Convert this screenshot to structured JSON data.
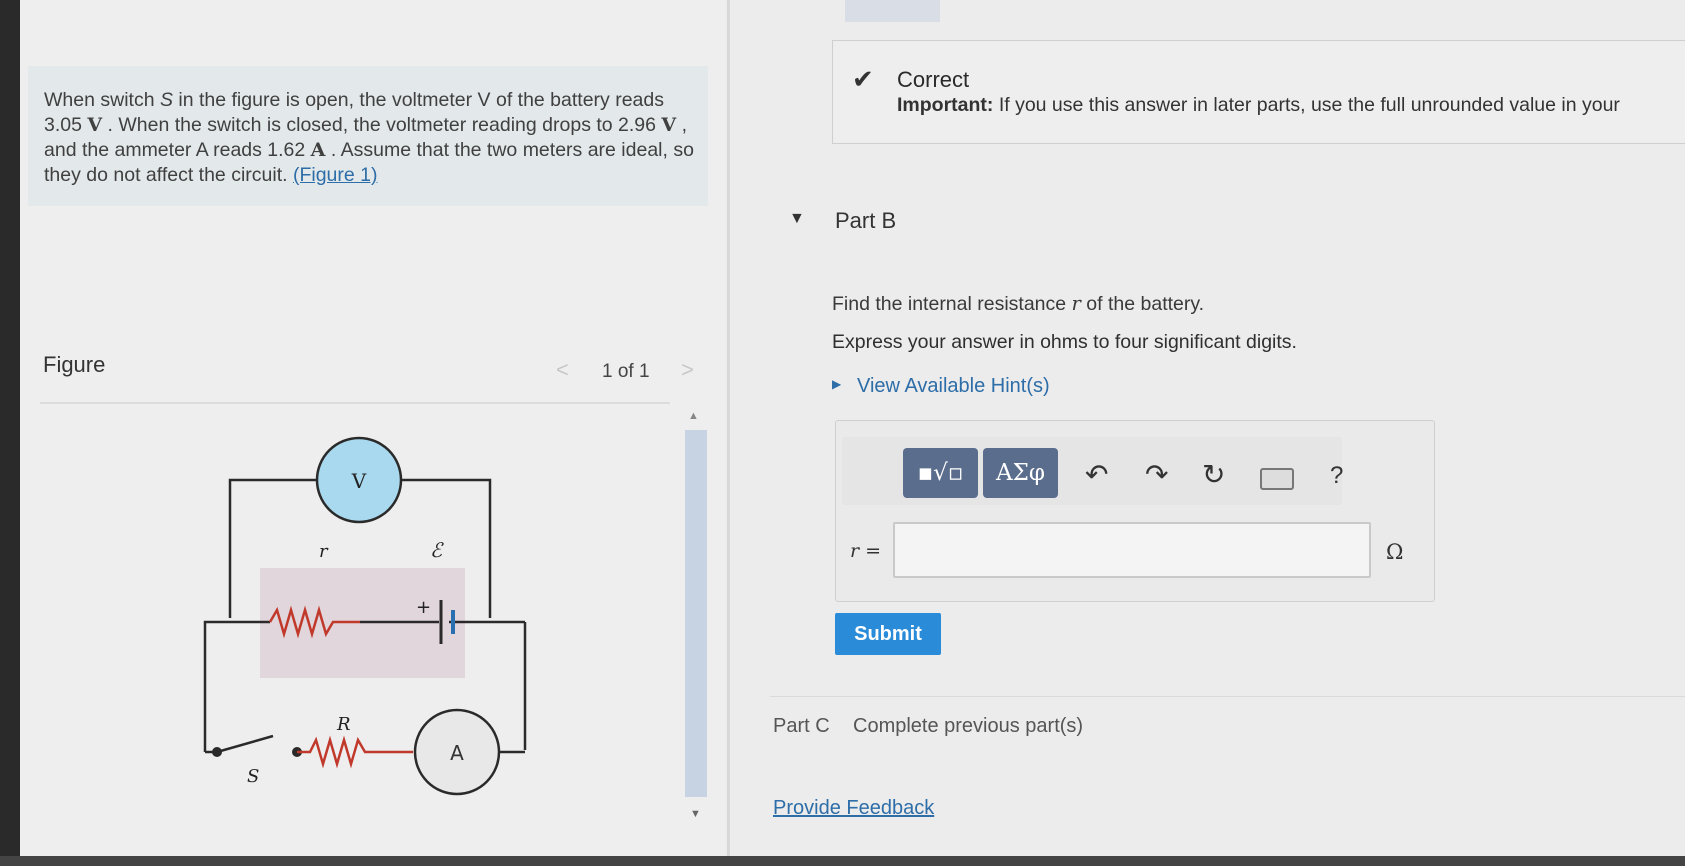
{
  "problem": {
    "text_1": "When switch ",
    "switch_symbol": "S",
    "text_2": " in the figure is open, the voltmeter V of the battery reads 3.05 ",
    "unit_v1": "V",
    "text_3": " . When the switch is closed, the voltmeter reading drops to 2.96 ",
    "unit_v2": "V",
    "text_4": " , and the ammeter A reads 1.62 ",
    "unit_a": "A",
    "text_5": " . Assume that the two meters are ideal, so they do not affect the circuit. ",
    "figure_link": "(Figure 1)"
  },
  "figure": {
    "label": "Figure",
    "counter": "1 of 1",
    "prev_glyph": "<",
    "next_glyph": ">",
    "circuit_labels": {
      "voltmeter": "V",
      "ammeter": "A",
      "r": "r",
      "emf": "ℰ",
      "plus": "+",
      "R": "R",
      "S": "S"
    }
  },
  "feedback": {
    "status": "Correct",
    "important_label": "Important:",
    "important_text": " If you use this answer in later parts, use the full unrounded value in your"
  },
  "part_b": {
    "title": "Part B",
    "question_1": "Find the internal resistance ",
    "question_symbol": "r",
    "question_2": " of the battery.",
    "instruction": "Express your answer in ohms to four significant digits.",
    "hint_link": "View Available Hint(s)",
    "toolbar": {
      "templates_glyph": "▪√▫",
      "symbols_label": "ΑΣφ",
      "undo_glyph": "↶",
      "redo_glyph": "↷",
      "reset_glyph": "↻",
      "help_glyph": "?"
    },
    "input_label_symbol": "r",
    "input_label_eq": " =",
    "input_value": "",
    "unit": "Ω",
    "submit_label": "Submit"
  },
  "part_c": {
    "label": "Part C",
    "status": "Complete previous part(s)"
  },
  "footer": {
    "feedback_link": "Provide Feedback"
  }
}
